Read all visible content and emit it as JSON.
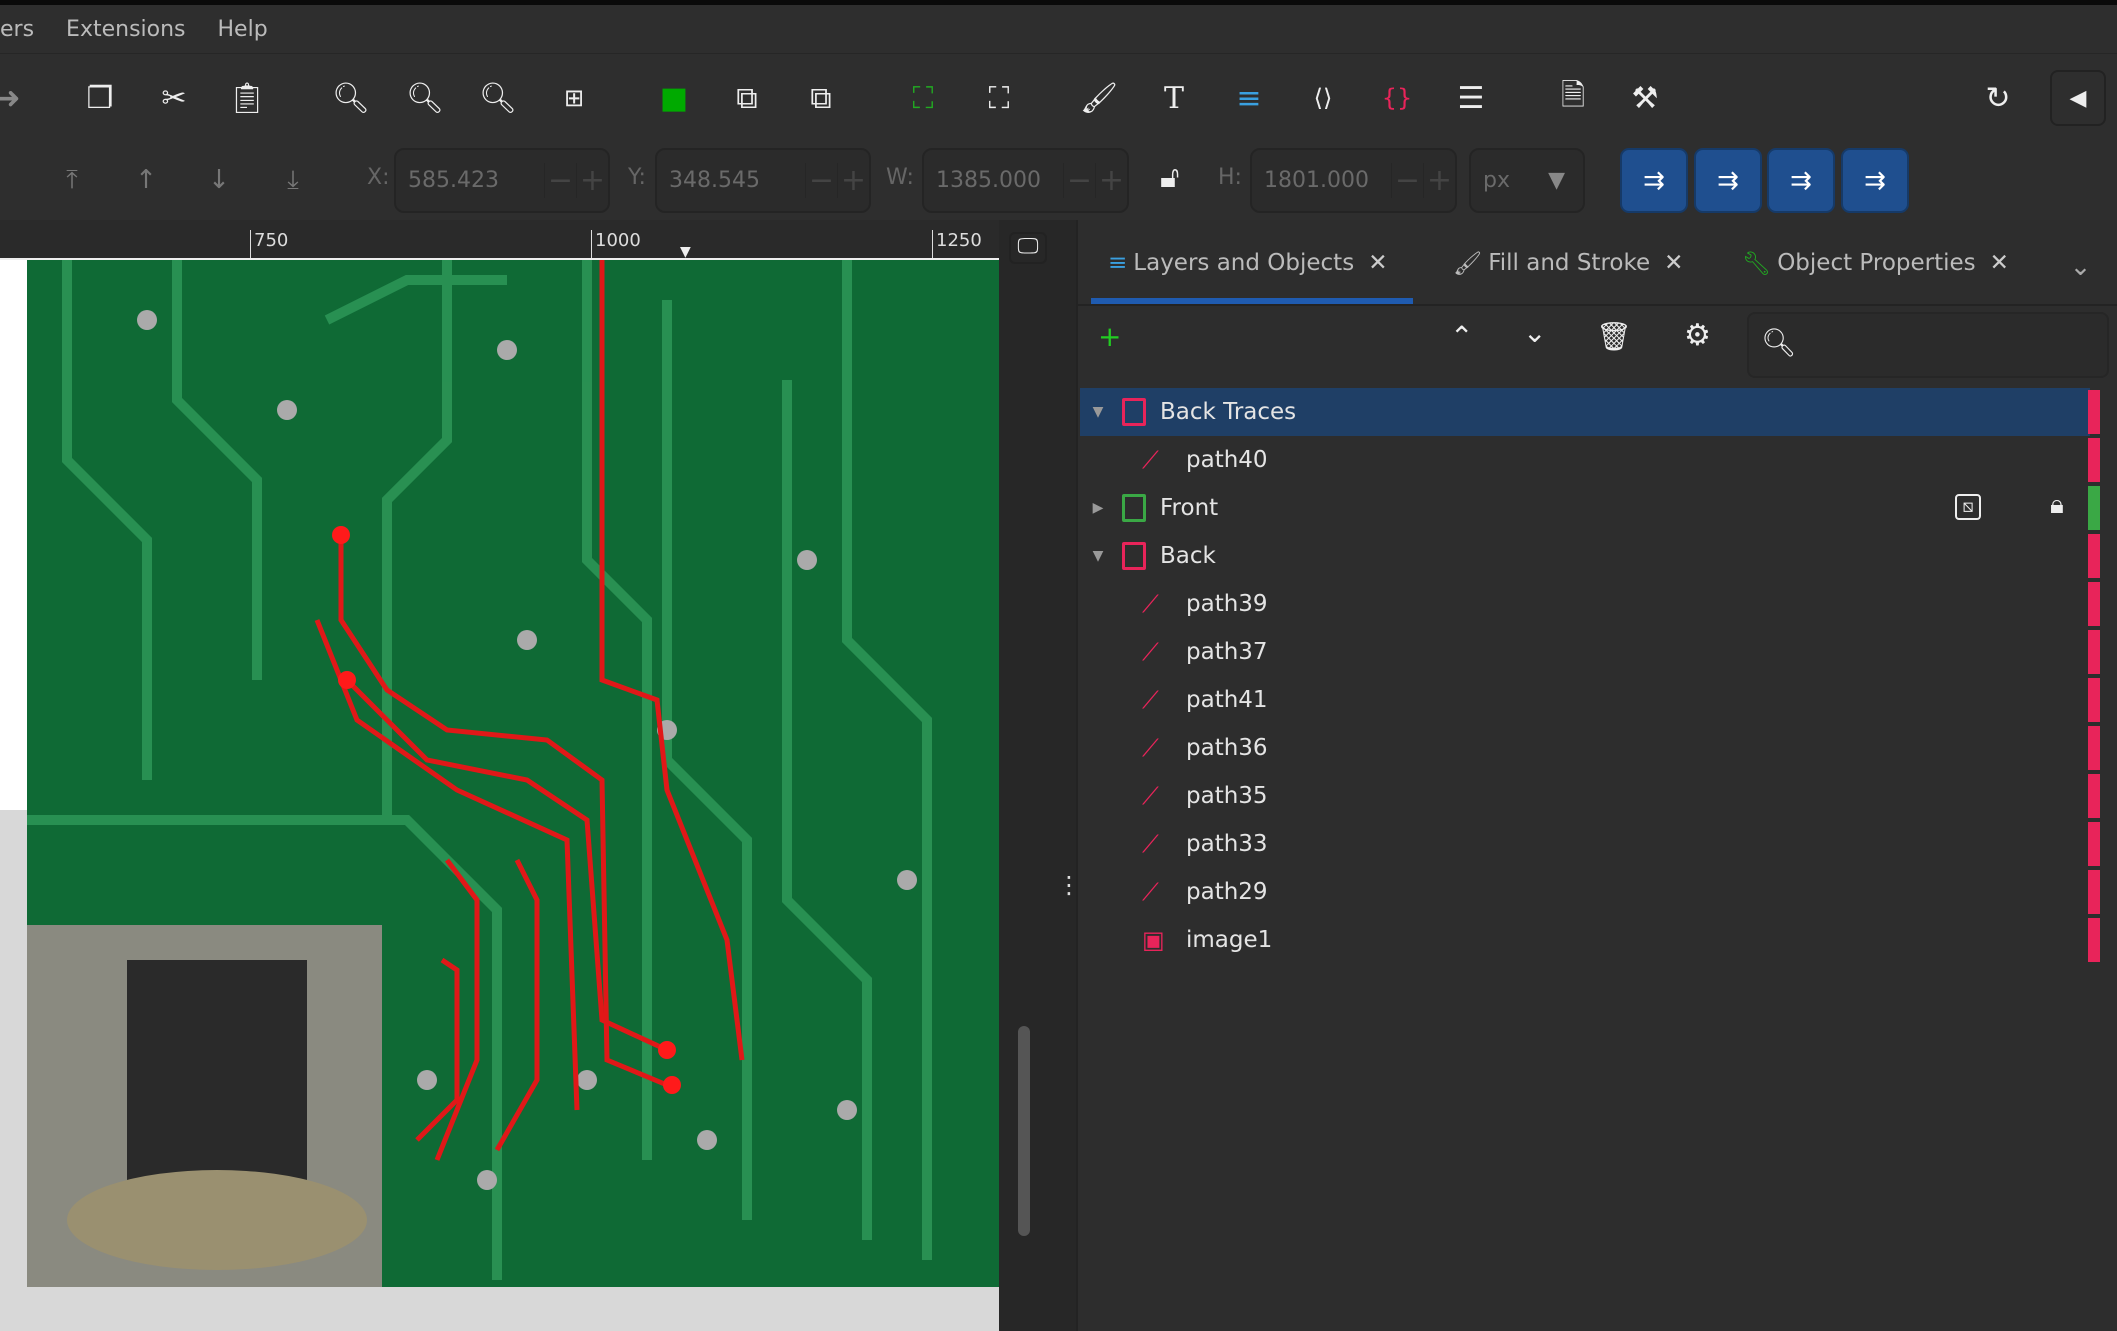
{
  "menu": {
    "items": [
      "ers",
      "Extensions",
      "Help"
    ]
  },
  "toolbar": {
    "icons": [
      "redo-icon",
      "duplicate-icon",
      "cut-icon",
      "paste-icon",
      "zoom-selection-icon",
      "zoom-drawing-icon",
      "zoom-page-icon",
      "zoom-center-icon",
      "group-icon",
      "lock-group-icon",
      "unlock-group-icon",
      "select-same-icon",
      "select-all-icon",
      "fill-stroke-icon",
      "text-icon",
      "layers-icon",
      "xml-editor-icon",
      "css-selectors-icon",
      "align-icon",
      "document-properties-icon",
      "preferences-icon",
      "snap-icon",
      "collapse-icon"
    ]
  },
  "transform": {
    "x_label": "X:",
    "x": "585.423",
    "y_label": "Y:",
    "y": "348.545",
    "w_label": "W:",
    "w": "1385.000",
    "h_label": "H:",
    "h": "1801.000",
    "unit": "px"
  },
  "ruler": {
    "labels": [
      "750",
      "1000",
      "1250"
    ]
  },
  "panel": {
    "tabs": [
      {
        "label": "Layers and Objects",
        "close": "✕"
      },
      {
        "label": "Fill and Stroke",
        "close": "✕"
      },
      {
        "label": "Object Properties",
        "close": "✕"
      }
    ],
    "rows": [
      {
        "label": "Back Traces",
        "type": "layer",
        "expanded": true,
        "selected": true,
        "color": "#e8245a"
      },
      {
        "label": "path40",
        "type": "path",
        "color": "#e8245a"
      },
      {
        "label": "Front",
        "type": "layer",
        "expanded": false,
        "hidden": true,
        "locked": true,
        "color": "#3aa845"
      },
      {
        "label": "Back",
        "type": "layer",
        "expanded": true,
        "color": "#e8245a"
      },
      {
        "label": "path39",
        "type": "path",
        "color": "#e8245a"
      },
      {
        "label": "path37",
        "type": "path",
        "color": "#e8245a"
      },
      {
        "label": "path41",
        "type": "path",
        "color": "#e8245a"
      },
      {
        "label": "path36",
        "type": "path",
        "color": "#e8245a"
      },
      {
        "label": "path35",
        "type": "path",
        "color": "#e8245a"
      },
      {
        "label": "path33",
        "type": "path",
        "color": "#e8245a"
      },
      {
        "label": "path29",
        "type": "path",
        "color": "#e8245a"
      },
      {
        "label": "image1",
        "type": "image",
        "color": "#e8245a"
      }
    ]
  },
  "colors": {
    "accent": "#1f4f8f",
    "selection": "#1f3f66",
    "layer_red": "#e8245a",
    "layer_green": "#3aa845",
    "trace_red": "#e01818",
    "pcb_green": "#0f6a35"
  }
}
